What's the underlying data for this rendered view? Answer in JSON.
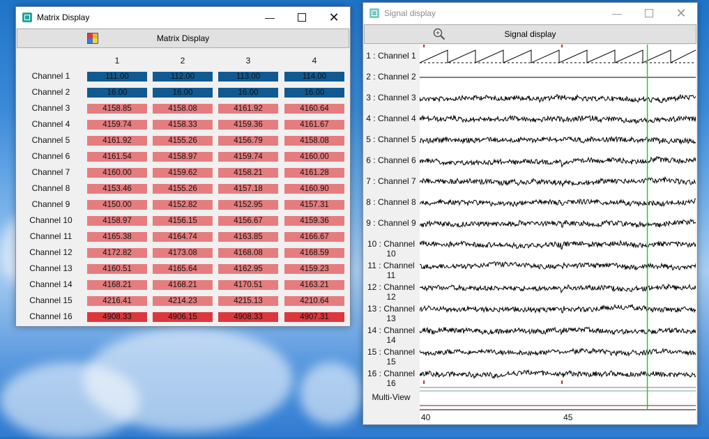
{
  "matrix_window": {
    "title": "Matrix Display",
    "toolbar_label": "Matrix Display",
    "toolbar_icon": "palette-icon",
    "columns": [
      "1",
      "2",
      "3",
      "4"
    ],
    "colors": {
      "low": "#115a91",
      "mid": "#e57d80",
      "high": "#db383d"
    },
    "rows": [
      {
        "label": "Channel 1",
        "values": [
          "111.00",
          "112.00",
          "113.00",
          "114.00"
        ],
        "color": "low"
      },
      {
        "label": "Channel 2",
        "values": [
          "16.00",
          "16.00",
          "16.00",
          "16.00"
        ],
        "color": "low"
      },
      {
        "label": "Channel 3",
        "values": [
          "4158.85",
          "4158.08",
          "4161.92",
          "4160.64"
        ],
        "color": "mid"
      },
      {
        "label": "Channel 4",
        "values": [
          "4159.74",
          "4158.33",
          "4159.36",
          "4161.67"
        ],
        "color": "mid"
      },
      {
        "label": "Channel 5",
        "values": [
          "4161.92",
          "4155.26",
          "4156.79",
          "4158.08"
        ],
        "color": "mid"
      },
      {
        "label": "Channel 6",
        "values": [
          "4161.54",
          "4158.97",
          "4159.74",
          "4160.00"
        ],
        "color": "mid"
      },
      {
        "label": "Channel 7",
        "values": [
          "4160.00",
          "4159.62",
          "4158.21",
          "4161.28"
        ],
        "color": "mid"
      },
      {
        "label": "Channel 8",
        "values": [
          "4153.46",
          "4155.26",
          "4157.18",
          "4160.90"
        ],
        "color": "mid"
      },
      {
        "label": "Channel 9",
        "values": [
          "4150.00",
          "4152.82",
          "4152.95",
          "4157.31"
        ],
        "color": "mid"
      },
      {
        "label": "Channel 10",
        "values": [
          "4158.97",
          "4156.15",
          "4156.67",
          "4159.36"
        ],
        "color": "mid"
      },
      {
        "label": "Channel 11",
        "values": [
          "4165.38",
          "4164.74",
          "4163.85",
          "4166.67"
        ],
        "color": "mid"
      },
      {
        "label": "Channel 12",
        "values": [
          "4172.82",
          "4173.08",
          "4168.08",
          "4168.59"
        ],
        "color": "mid"
      },
      {
        "label": "Channel 13",
        "values": [
          "4160.51",
          "4165.64",
          "4162.95",
          "4159.23"
        ],
        "color": "mid"
      },
      {
        "label": "Channel 14",
        "values": [
          "4168.21",
          "4168.21",
          "4170.51",
          "4163.21"
        ],
        "color": "mid"
      },
      {
        "label": "Channel 15",
        "values": [
          "4216.41",
          "4214.23",
          "4215.13",
          "4210.64"
        ],
        "color": "mid"
      },
      {
        "label": "Channel 16",
        "values": [
          "4908.33",
          "4906.15",
          "4908.33",
          "4907.31"
        ],
        "color": "high"
      }
    ]
  },
  "signal_window": {
    "title": "Signal display",
    "toolbar_label": "Signal display",
    "toolbar_icon": "zoom-icon",
    "channels": [
      "1 : Channel 1",
      "2 : Channel 2",
      "3 : Channel 3",
      "4 : Channel 4",
      "5 : Channel 5",
      "6 : Channel 6",
      "7 : Channel 7",
      "8 : Channel 8",
      "9 : Channel 9",
      "10 : Channel 10",
      "11 : Channel 11",
      "12 : Channel 12",
      "13 : Channel 13",
      "14 : Channel 14",
      "15 : Channel 15",
      "16 : Channel 16"
    ],
    "multiview_label": "Multi-View",
    "time_axis": {
      "start": 40,
      "end": 49.7,
      "cursor": 48.0,
      "marker": 45.0,
      "ticks": [
        "40",
        "45"
      ]
    },
    "colors": {
      "cursor": "#22cc22",
      "marker": "#cc2222",
      "trace": "#000000"
    }
  }
}
